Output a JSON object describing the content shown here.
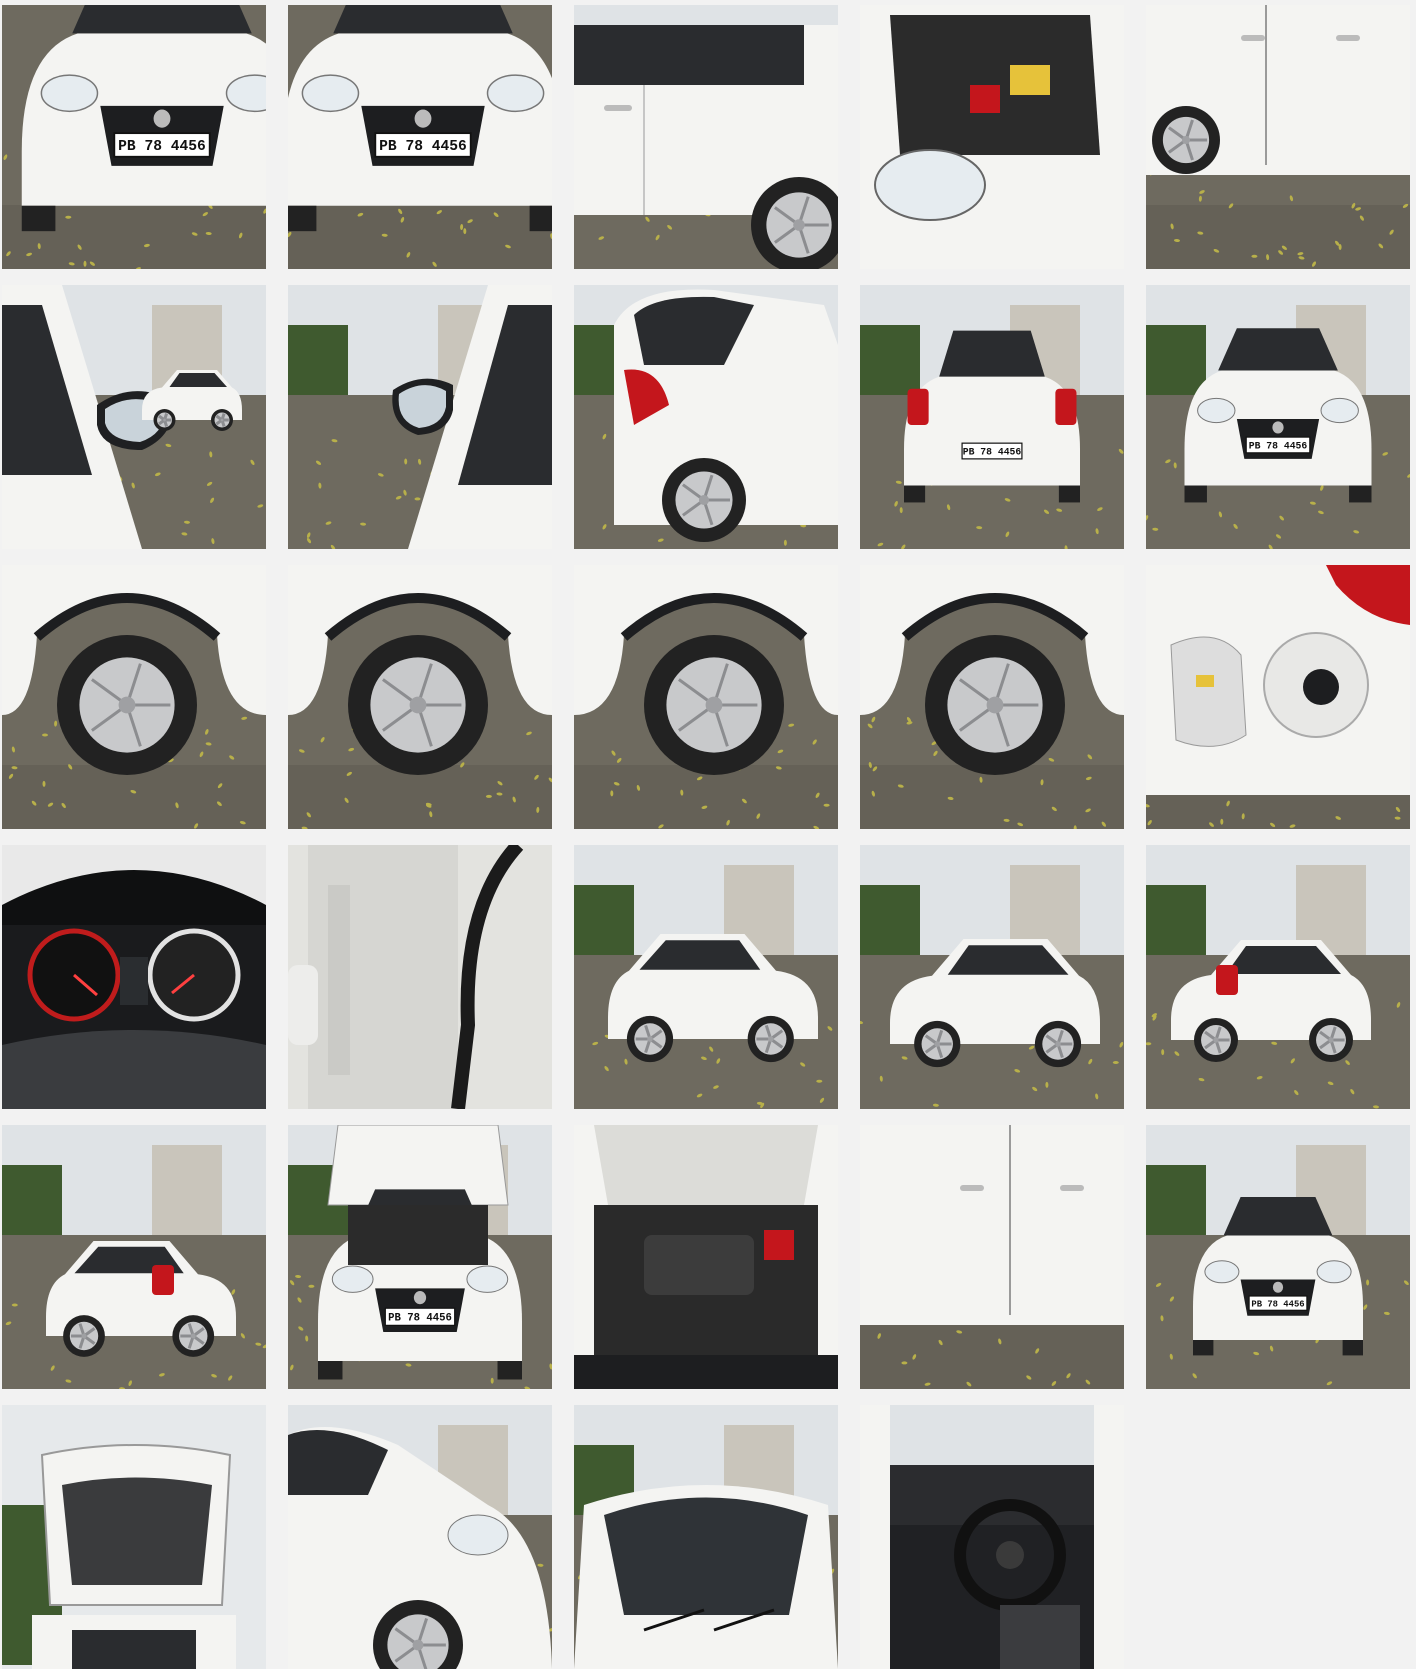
{
  "plate_number": "PB 78 4456",
  "colors": {
    "ground": "#6e6a5f",
    "ground_dark": "#57544b",
    "leaf": "#b8b04a",
    "car_white": "#f4f4f2",
    "car_shadow": "#d9d9d6",
    "trim_black": "#1d1e20",
    "tyre": "#222222",
    "hubcap": "#c8c9cb",
    "light_red": "#c4161c",
    "sky": "#dfe3e6",
    "building": "#c9c5bb",
    "tree": "#3f5a2f",
    "cabin": "#2a2c2f"
  },
  "gallery": {
    "photos": [
      {
        "view": "front-left-corner",
        "icon": "car-front-icon"
      },
      {
        "view": "front-right-corner",
        "icon": "car-front-icon"
      },
      {
        "view": "left-rear-door",
        "icon": "car-door-icon"
      },
      {
        "view": "engine-bay-headlamp",
        "icon": "engine-icon"
      },
      {
        "view": "right-side-doors",
        "icon": "car-door-icon"
      },
      {
        "view": "left-mirror",
        "icon": "mirror-icon"
      },
      {
        "view": "right-mirror",
        "icon": "mirror-icon"
      },
      {
        "view": "rear-left-quarter",
        "icon": "car-rear-icon"
      },
      {
        "view": "rear-view",
        "icon": "car-rear-icon"
      },
      {
        "view": "front-view",
        "icon": "car-front-icon"
      },
      {
        "view": "wheel-front-left",
        "icon": "wheel-icon"
      },
      {
        "view": "wheel-rear-left",
        "icon": "wheel-icon"
      },
      {
        "view": "wheel-front-right",
        "icon": "wheel-icon"
      },
      {
        "view": "wheel-rear-right",
        "icon": "wheel-icon"
      },
      {
        "view": "fuel-cap",
        "icon": "fuel-cap-icon"
      },
      {
        "view": "instrument-cluster",
        "icon": "speedometer-icon"
      },
      {
        "view": "chassis-number",
        "icon": "chassis-icon"
      },
      {
        "view": "front-left-three-quarter",
        "icon": "car-side-icon"
      },
      {
        "view": "front-right-three-quarter",
        "icon": "car-side-icon"
      },
      {
        "view": "rear-right-three-quarter",
        "icon": "car-rear-icon"
      },
      {
        "view": "rear-left-three-quarter",
        "icon": "car-rear-icon"
      },
      {
        "view": "bonnet-open-front",
        "icon": "engine-icon"
      },
      {
        "view": "engine-closeup",
        "icon": "engine-icon"
      },
      {
        "view": "left-doors-closeup",
        "icon": "car-door-icon"
      },
      {
        "view": "front-view-far",
        "icon": "car-front-icon"
      },
      {
        "view": "boot-open",
        "icon": "boot-icon"
      },
      {
        "view": "front-left-fender",
        "icon": "car-side-icon"
      },
      {
        "view": "windscreen",
        "icon": "windscreen-icon"
      },
      {
        "view": "interior-dashboard",
        "icon": "steering-wheel-icon"
      }
    ]
  }
}
